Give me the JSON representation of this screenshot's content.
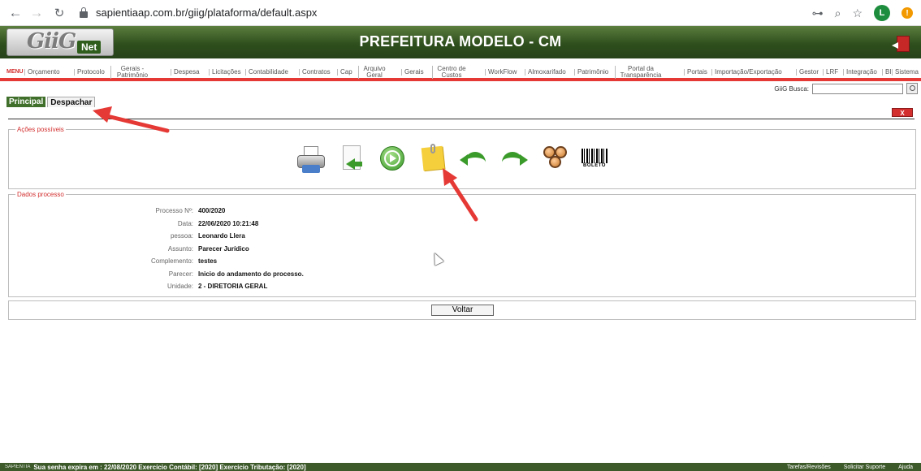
{
  "browser": {
    "url": "sapientiaap.com.br/giig/plataforma/default.aspx",
    "profile_initial": "L",
    "update_badge": "!"
  },
  "header": {
    "logo_main": "GiiG",
    "logo_sub": "Net",
    "title": "PREFEITURA MODELO - CM"
  },
  "menu": {
    "label": "MENU",
    "items": [
      "Orçamento",
      "Protocolo",
      "Gerais - Patrimônio",
      "Despesa",
      "Licitações",
      "Contabilidade",
      "Contratos",
      "Cap",
      "Arquivo Geral",
      "Gerais",
      "Centro de Custos",
      "WorkFlow",
      "Almoxarifado",
      "Patrimônio",
      "Portal da Transparência",
      "Portais",
      "Importação/Exportação",
      "Gestor",
      "LRF",
      "Integração",
      "BI",
      "Sistema"
    ],
    "search_label": "GiiG Busca:",
    "search_value": ""
  },
  "tabs": {
    "principal": "Principal",
    "despachar": "Despachar"
  },
  "close_label": "X",
  "acoes": {
    "legend": "Ações possíveis",
    "barcode_text": "BOLETO",
    "icons": [
      "printer-icon",
      "return-document-icon",
      "forward-circle-icon",
      "sticky-note-icon",
      "undo-arrow-icon",
      "redo-arrow-icon",
      "users-group-icon",
      "barcode-icon"
    ]
  },
  "dados": {
    "legend": "Dados processo",
    "rows": [
      {
        "label": "Processo Nº:",
        "value": "400/2020"
      },
      {
        "label": "Data:",
        "value": "22/06/2020 10:21:48"
      },
      {
        "label": "pessoa:",
        "value": "Leonardo Llera"
      },
      {
        "label": "Assunto:",
        "value": "Parecer Jurídico"
      },
      {
        "label": "Complemento:",
        "value": "testes"
      },
      {
        "label": "Parecer:",
        "value": "Inicio do andamento do processo."
      },
      {
        "label": "Unidade:",
        "value": "2 - DIRETORIA GERAL"
      }
    ]
  },
  "voltar_label": "Voltar",
  "footer": {
    "brand": "SAPIENTIA",
    "message": "Sua senha expira em : 22/08/2020    Exercício Contábil: [2020]    Exercício Tributação: [2020]",
    "links": [
      "Tarefas/Revisões",
      "Solicitar Suporte",
      "Ajuda"
    ]
  },
  "colors": {
    "accent_green": "#3f6f2a",
    "menu_red": "#e53935",
    "annotation_red": "#e53935"
  }
}
